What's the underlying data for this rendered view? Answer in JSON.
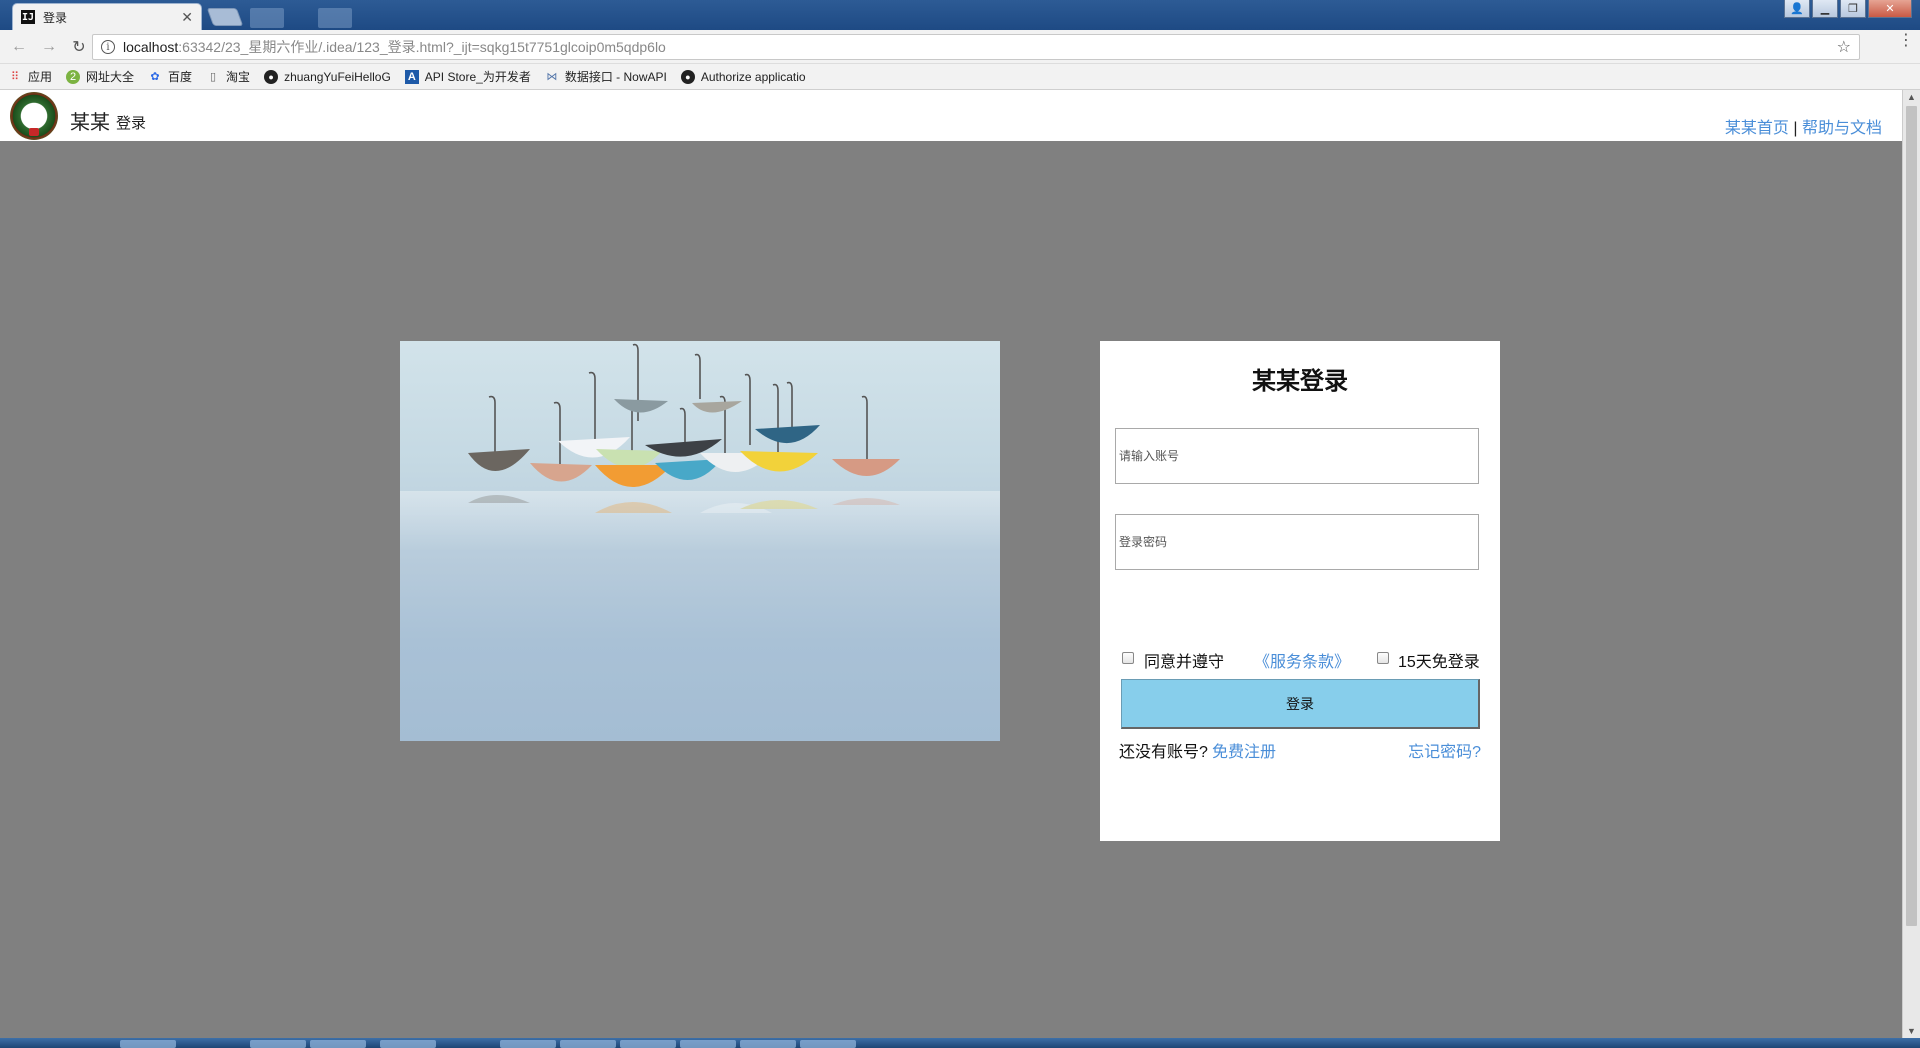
{
  "browser": {
    "tab_title": "登录",
    "favicon_text": "IJ",
    "url_host": "localhost",
    "url_rest": ":63342/23_星期六作业/.idea/123_登录.html?_ijt=sqkg15t7751glcoip0m5qdp6lo",
    "bookmarks": [
      {
        "label": "应用",
        "icon": "apps-grid-icon"
      },
      {
        "label": "网址大全",
        "icon": "hao123-icon"
      },
      {
        "label": "百度",
        "icon": "baidu-paw-icon"
      },
      {
        "label": "淘宝",
        "icon": "page-icon"
      },
      {
        "label": "zhuangYuFeiHelloG",
        "icon": "github-icon"
      },
      {
        "label": "API Store_为开发者",
        "icon": "apistore-icon"
      },
      {
        "label": "数据接口 - NowAPI",
        "icon": "share-icon"
      },
      {
        "label": "Authorize applicatio",
        "icon": "github-icon"
      }
    ]
  },
  "site": {
    "name": "某某",
    "subtitle": "登录",
    "home_link": "某某首页",
    "separator": "|",
    "help_link": "帮助与文档"
  },
  "login": {
    "title": "某某登录",
    "account_placeholder": "请输入账号",
    "password_placeholder": "登录密码",
    "agree_text": "同意并遵守",
    "terms_link": "《服务条款》",
    "remember_text": "15天免登录",
    "submit_label": "登录",
    "no_account_text": "还没有账号?",
    "register_link": "免费注册",
    "forgot_link": "忘记密码?"
  },
  "colors": {
    "link": "#4a8ed8",
    "button": "#87ceeb",
    "page_bg": "#808080"
  }
}
